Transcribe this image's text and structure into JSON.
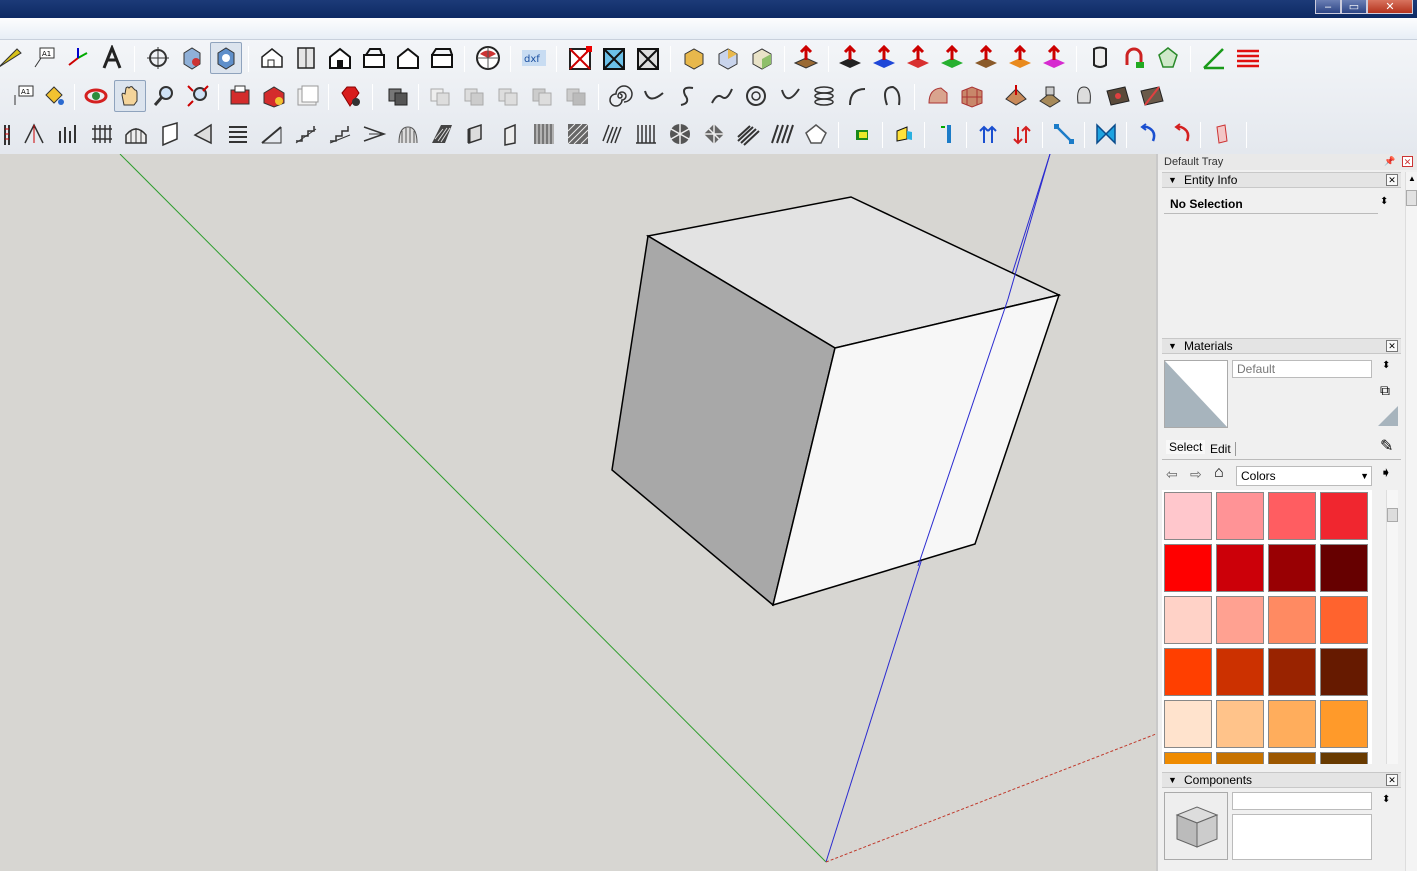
{
  "window": {
    "minimize_glyph": "–",
    "restore_glyph": "▭",
    "close_glyph": "✕"
  },
  "tray": {
    "title": "Default Tray",
    "entity_info": {
      "title": "Entity Info",
      "selection_text": "No Selection"
    },
    "materials": {
      "title": "Materials",
      "material_name": "Default",
      "tabs": [
        "Select",
        "Edit"
      ],
      "library_select": "Colors",
      "swatches": [
        "#ffc7cc",
        "#ff9396",
        "#ff5d61",
        "#f0262f",
        "#ff0000",
        "#cc0009",
        "#990003",
        "#660000",
        "#ffd2c7",
        "#ffa191",
        "#ff8a62",
        "#ff632e",
        "#ff3f00",
        "#cc3100",
        "#992300",
        "#661a00",
        "#ffe3cd",
        "#ffc38a",
        "#ffad5c",
        "#ff9a2a",
        "#ef8b00",
        "#c77200",
        "#9c5700",
        "#683a00"
      ]
    },
    "components": {
      "title": "Components"
    }
  },
  "colors": {
    "x_axis": "#c0392b",
    "y_axis": "#2e9e2e",
    "z_axis": "#2b2bd0",
    "face_light": "#f7f7f7",
    "face_top": "#e3e3e3",
    "face_shade": "#a8a8a8",
    "titlebar": "#0d2a63"
  },
  "icons": [
    "protractor-icon",
    "text-icon",
    "axes-icon",
    "3d-text-icon",
    "orbit-icon",
    "section-plane-icon",
    "walkthrough-icon",
    "iso-view-icon",
    "top-view-icon",
    "front-view-icon",
    "right-view-icon",
    "back-view-icon",
    "left-view-icon",
    "geo-location-icon",
    "dxf-export-icon",
    "plugin-icons",
    "extrude-icons",
    "curve-icons"
  ]
}
